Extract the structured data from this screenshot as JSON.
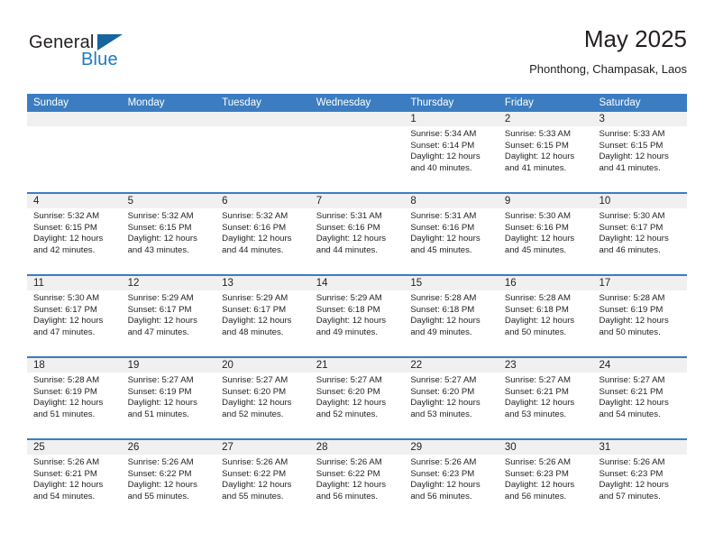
{
  "brand": {
    "name_top": "General",
    "name_bottom": "Blue",
    "triangle_color": "#15659f",
    "blue": "#1f7ac2"
  },
  "header": {
    "title": "May 2025",
    "location": "Phonthong, Champasak, Laos"
  },
  "colors": {
    "header_blue": "#3b7dc0",
    "row_divider_blue": "#3b7dc0",
    "date_band_gray": "#f0f0f0",
    "text": "#231f20"
  },
  "weekday_headers": [
    "Sunday",
    "Monday",
    "Tuesday",
    "Wednesday",
    "Thursday",
    "Friday",
    "Saturday"
  ],
  "labels": {
    "sunrise_prefix": "Sunrise:",
    "sunset_prefix": "Sunset:",
    "daylight_prefix": "Daylight:"
  },
  "weeks": [
    [
      {
        "day": "",
        "empty": true
      },
      {
        "day": "",
        "empty": true
      },
      {
        "day": "",
        "empty": true
      },
      {
        "day": "",
        "empty": true
      },
      {
        "day": "1",
        "sunrise": "Sunrise: 5:34 AM",
        "sunset": "Sunset: 6:14 PM",
        "daylight_1": "Daylight: 12 hours",
        "daylight_2": "and 40 minutes."
      },
      {
        "day": "2",
        "sunrise": "Sunrise: 5:33 AM",
        "sunset": "Sunset: 6:15 PM",
        "daylight_1": "Daylight: 12 hours",
        "daylight_2": "and 41 minutes."
      },
      {
        "day": "3",
        "sunrise": "Sunrise: 5:33 AM",
        "sunset": "Sunset: 6:15 PM",
        "daylight_1": "Daylight: 12 hours",
        "daylight_2": "and 41 minutes."
      }
    ],
    [
      {
        "day": "4",
        "sunrise": "Sunrise: 5:32 AM",
        "sunset": "Sunset: 6:15 PM",
        "daylight_1": "Daylight: 12 hours",
        "daylight_2": "and 42 minutes."
      },
      {
        "day": "5",
        "sunrise": "Sunrise: 5:32 AM",
        "sunset": "Sunset: 6:15 PM",
        "daylight_1": "Daylight: 12 hours",
        "daylight_2": "and 43 minutes."
      },
      {
        "day": "6",
        "sunrise": "Sunrise: 5:32 AM",
        "sunset": "Sunset: 6:16 PM",
        "daylight_1": "Daylight: 12 hours",
        "daylight_2": "and 44 minutes."
      },
      {
        "day": "7",
        "sunrise": "Sunrise: 5:31 AM",
        "sunset": "Sunset: 6:16 PM",
        "daylight_1": "Daylight: 12 hours",
        "daylight_2": "and 44 minutes."
      },
      {
        "day": "8",
        "sunrise": "Sunrise: 5:31 AM",
        "sunset": "Sunset: 6:16 PM",
        "daylight_1": "Daylight: 12 hours",
        "daylight_2": "and 45 minutes."
      },
      {
        "day": "9",
        "sunrise": "Sunrise: 5:30 AM",
        "sunset": "Sunset: 6:16 PM",
        "daylight_1": "Daylight: 12 hours",
        "daylight_2": "and 45 minutes."
      },
      {
        "day": "10",
        "sunrise": "Sunrise: 5:30 AM",
        "sunset": "Sunset: 6:17 PM",
        "daylight_1": "Daylight: 12 hours",
        "daylight_2": "and 46 minutes."
      }
    ],
    [
      {
        "day": "11",
        "sunrise": "Sunrise: 5:30 AM",
        "sunset": "Sunset: 6:17 PM",
        "daylight_1": "Daylight: 12 hours",
        "daylight_2": "and 47 minutes."
      },
      {
        "day": "12",
        "sunrise": "Sunrise: 5:29 AM",
        "sunset": "Sunset: 6:17 PM",
        "daylight_1": "Daylight: 12 hours",
        "daylight_2": "and 47 minutes."
      },
      {
        "day": "13",
        "sunrise": "Sunrise: 5:29 AM",
        "sunset": "Sunset: 6:17 PM",
        "daylight_1": "Daylight: 12 hours",
        "daylight_2": "and 48 minutes."
      },
      {
        "day": "14",
        "sunrise": "Sunrise: 5:29 AM",
        "sunset": "Sunset: 6:18 PM",
        "daylight_1": "Daylight: 12 hours",
        "daylight_2": "and 49 minutes."
      },
      {
        "day": "15",
        "sunrise": "Sunrise: 5:28 AM",
        "sunset": "Sunset: 6:18 PM",
        "daylight_1": "Daylight: 12 hours",
        "daylight_2": "and 49 minutes."
      },
      {
        "day": "16",
        "sunrise": "Sunrise: 5:28 AM",
        "sunset": "Sunset: 6:18 PM",
        "daylight_1": "Daylight: 12 hours",
        "daylight_2": "and 50 minutes."
      },
      {
        "day": "17",
        "sunrise": "Sunrise: 5:28 AM",
        "sunset": "Sunset: 6:19 PM",
        "daylight_1": "Daylight: 12 hours",
        "daylight_2": "and 50 minutes."
      }
    ],
    [
      {
        "day": "18",
        "sunrise": "Sunrise: 5:28 AM",
        "sunset": "Sunset: 6:19 PM",
        "daylight_1": "Daylight: 12 hours",
        "daylight_2": "and 51 minutes."
      },
      {
        "day": "19",
        "sunrise": "Sunrise: 5:27 AM",
        "sunset": "Sunset: 6:19 PM",
        "daylight_1": "Daylight: 12 hours",
        "daylight_2": "and 51 minutes."
      },
      {
        "day": "20",
        "sunrise": "Sunrise: 5:27 AM",
        "sunset": "Sunset: 6:20 PM",
        "daylight_1": "Daylight: 12 hours",
        "daylight_2": "and 52 minutes."
      },
      {
        "day": "21",
        "sunrise": "Sunrise: 5:27 AM",
        "sunset": "Sunset: 6:20 PM",
        "daylight_1": "Daylight: 12 hours",
        "daylight_2": "and 52 minutes."
      },
      {
        "day": "22",
        "sunrise": "Sunrise: 5:27 AM",
        "sunset": "Sunset: 6:20 PM",
        "daylight_1": "Daylight: 12 hours",
        "daylight_2": "and 53 minutes."
      },
      {
        "day": "23",
        "sunrise": "Sunrise: 5:27 AM",
        "sunset": "Sunset: 6:21 PM",
        "daylight_1": "Daylight: 12 hours",
        "daylight_2": "and 53 minutes."
      },
      {
        "day": "24",
        "sunrise": "Sunrise: 5:27 AM",
        "sunset": "Sunset: 6:21 PM",
        "daylight_1": "Daylight: 12 hours",
        "daylight_2": "and 54 minutes."
      }
    ],
    [
      {
        "day": "25",
        "sunrise": "Sunrise: 5:26 AM",
        "sunset": "Sunset: 6:21 PM",
        "daylight_1": "Daylight: 12 hours",
        "daylight_2": "and 54 minutes."
      },
      {
        "day": "26",
        "sunrise": "Sunrise: 5:26 AM",
        "sunset": "Sunset: 6:22 PM",
        "daylight_1": "Daylight: 12 hours",
        "daylight_2": "and 55 minutes."
      },
      {
        "day": "27",
        "sunrise": "Sunrise: 5:26 AM",
        "sunset": "Sunset: 6:22 PM",
        "daylight_1": "Daylight: 12 hours",
        "daylight_2": "and 55 minutes."
      },
      {
        "day": "28",
        "sunrise": "Sunrise: 5:26 AM",
        "sunset": "Sunset: 6:22 PM",
        "daylight_1": "Daylight: 12 hours",
        "daylight_2": "and 56 minutes."
      },
      {
        "day": "29",
        "sunrise": "Sunrise: 5:26 AM",
        "sunset": "Sunset: 6:23 PM",
        "daylight_1": "Daylight: 12 hours",
        "daylight_2": "and 56 minutes."
      },
      {
        "day": "30",
        "sunrise": "Sunrise: 5:26 AM",
        "sunset": "Sunset: 6:23 PM",
        "daylight_1": "Daylight: 12 hours",
        "daylight_2": "and 56 minutes."
      },
      {
        "day": "31",
        "sunrise": "Sunrise: 5:26 AM",
        "sunset": "Sunset: 6:23 PM",
        "daylight_1": "Daylight: 12 hours",
        "daylight_2": "and 57 minutes."
      }
    ]
  ]
}
